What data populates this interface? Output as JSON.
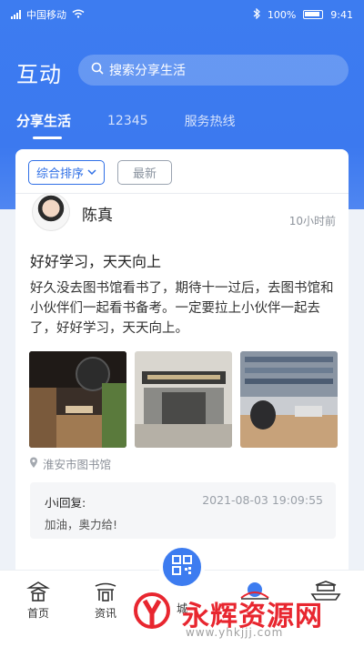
{
  "status_bar": {
    "carrier": "中国移动",
    "battery": "100%",
    "time": "9:41"
  },
  "header": {
    "title": "互动",
    "search_placeholder": "搜索分享生活"
  },
  "tabs": [
    {
      "label": "分享生活",
      "active": true
    },
    {
      "label": "12345",
      "active": false
    },
    {
      "label": "服务热线",
      "active": false
    }
  ],
  "sort": {
    "primary_label": "综合排序",
    "secondary_label": "最新"
  },
  "post": {
    "author": "陈真",
    "time": "10小时前",
    "title": "好好学习，天天向上",
    "body": "好久没去图书馆看书了，期待十一过后，去图书馆和小伙伴们一起看书备考。一定要拉上小伙伴一起去了，好好学习，天天向上。",
    "location": "淮安市图书馆",
    "reply": {
      "name": "小i回复:",
      "time": "2021-08-03  19:09:55",
      "text": "加油，奥力给!"
    }
  },
  "bottom_nav": [
    {
      "label": "首页",
      "icon": "home-pavilion-icon"
    },
    {
      "label": "资讯",
      "icon": "news-gate-icon"
    },
    {
      "label": "城",
      "icon": "qr-code-icon"
    },
    {
      "label": "",
      "icon": "bridge-icon"
    },
    {
      "label": "",
      "icon": "boat-icon"
    }
  ],
  "watermark": {
    "text": "永辉资源网",
    "url": "www.yhkjjj.com"
  },
  "colors": {
    "primary": "#3d7cf0",
    "watermark": "#e8262f"
  }
}
